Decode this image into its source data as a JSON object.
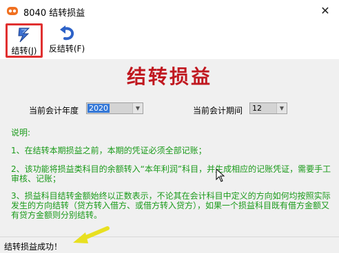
{
  "window": {
    "title": "8040 结转损益",
    "close_glyph": "✕"
  },
  "toolbar": {
    "close_label": "结转(J)",
    "reverse_label": "反结转(F)"
  },
  "main": {
    "title": "结转损益",
    "year_label": "当前会计年度",
    "year_value": "2020",
    "period_label": "当前会计期间",
    "period_value": "12"
  },
  "notes": {
    "heading": "说明:",
    "item1": "1、在结转本期损益之前，本期的凭证必须全部记账；",
    "item2": "2、该功能将损益类科目的余额转入“本年利润”科目，并生成相应的记账凭证，需要手工审核、记账；",
    "item3": "3、损益科目结转金额始终以正数表示，不论其在会计科目中定义的方向如何均按照实际发生的方向结转（贷方转入借方、或借方转入贷方），如果一个损益科目既有借方金额又有贷方金额则分别结转。"
  },
  "status": {
    "text": "结转损益成功！"
  },
  "colors": {
    "title_red": "#c01820",
    "notes_green": "#1a9a1a",
    "highlight_red": "#e03030",
    "annotation_yellow": "#e8e020"
  },
  "icons": {
    "app": "app-logo-icon",
    "close_action": "lightning-transfer-icon",
    "reverse_action": "undo-arrow-icon"
  }
}
